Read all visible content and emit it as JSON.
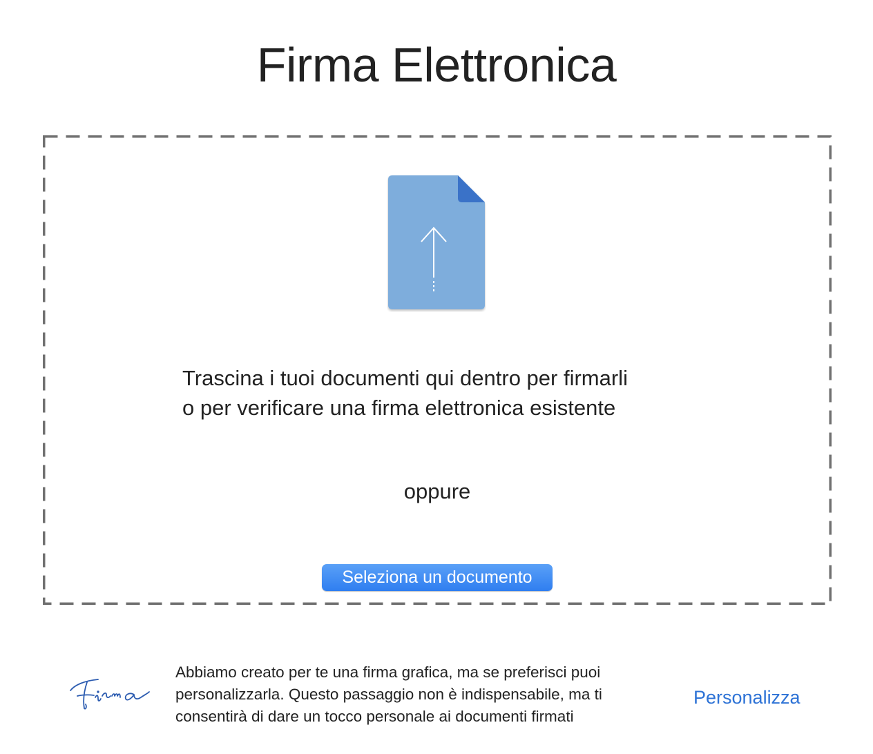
{
  "header": {
    "title": "Firma Elettronica"
  },
  "drop_zone": {
    "icon": "document-upload-icon",
    "instruction_line_1": "Trascina i tuoi documenti qui dentro per firmarli",
    "instruction_line_2": "o per verificare una firma elettronica esistente",
    "separator_text": "oppure",
    "select_button_label": "Seleziona un documento"
  },
  "footer": {
    "signature_icon": "signature-icon",
    "description_line_1": "Abbiamo creato per te una firma grafica, ma se preferisci puoi",
    "description_line_2": "personalizzarla. Questo passaggio non è indispensabile, ma ti",
    "description_line_3": "consentirà di dare un tocco personale ai documenti firmati",
    "personalize_label": "Personalizza"
  },
  "colors": {
    "accent": "#2e73d6",
    "button": "#3a86f2",
    "document_icon": "#7eaddc",
    "document_fold": "#3a72c8",
    "dashed_border": "#707070",
    "signature_ink": "#2b5bb0"
  }
}
